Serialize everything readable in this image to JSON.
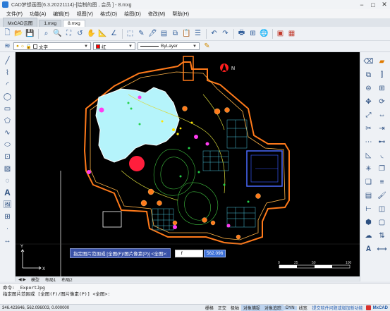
{
  "window": {
    "title": "CAD梦想画图(6.3.20221114)-[绘制的图 , 会员 ] - 8.mxg",
    "minimize_glyph": "−",
    "maximize_glyph": "□",
    "close_glyph": "✕"
  },
  "menu": [
    "文件(F)",
    "功能(A)",
    "编辑(E)",
    "视图(V)",
    "格式(O)",
    "绘图(D)",
    "修改(M)",
    "帮助(H)"
  ],
  "tabs": [
    {
      "label": "MxCAD云图",
      "active": false
    },
    {
      "label": "1.mxg",
      "active": false
    },
    {
      "label": "8.mxg",
      "active": true
    }
  ],
  "toolbar_icons": [
    "new-file-icon",
    "open-folder-icon",
    "save-icon",
    "zoom-window-icon",
    "zoom-realtime-icon",
    "zoom-extents-icon",
    "zoom-previous-icon",
    "pan-hand-icon",
    "measure-icon",
    "angle-icon",
    "select-box-icon",
    "edit-text-icon",
    "pen-icon",
    "layer-icon",
    "copy-icon",
    "paste-icon",
    "properties-icon",
    "undo-icon",
    "redo-icon",
    "print-icon",
    "publish-icon",
    "web-icon",
    "pdf-export-icon",
    "image-export-icon"
  ],
  "properties": {
    "layer_value": "文字",
    "color_value": "红",
    "linetype_value": "ByLayer"
  },
  "colors": {
    "canvas_bg": "#000000",
    "prompt_bg": "#3a52a8",
    "accent": "#1f5aa8",
    "pond": "#b5f4fb",
    "wall": "#ff7a1a",
    "hatch": "#4ac2d6"
  },
  "canvas": {
    "north_label": "N",
    "coord_label_x": "X",
    "coord_label_y": "Y",
    "scale_labels": [
      "0",
      "25",
      "50",
      "100"
    ]
  },
  "prompt": {
    "text": "指定图片范围或 [全图(F)/图片像素(P)] <全图>:",
    "input": "f",
    "value": "562.096"
  },
  "layout_tabs": [
    "模型",
    "布局1",
    "布局2"
  ],
  "command_lines": [
    "命令: _ExportJpg",
    "指定图片范围或 [全图(F)/图片像素(P)] <全图>:"
  ],
  "status": {
    "coords": "346.423646, 562.096003, 0.000000",
    "buttons": [
      {
        "label": "栅格",
        "on": false
      },
      {
        "label": "正交",
        "on": false
      },
      {
        "label": "极轴",
        "on": false
      },
      {
        "label": "对象捕捉",
        "on": true
      },
      {
        "label": "对象追踪",
        "on": true
      },
      {
        "label": "DYN",
        "on": true
      },
      {
        "label": "线宽",
        "on": false
      }
    ],
    "link": "提交软件问题或增加新功能",
    "brand": "MxCAD"
  },
  "left_icons": [
    "line-icon",
    "polyline-icon",
    "arc-icon",
    "circle-icon",
    "rectangle-icon",
    "polygon-icon",
    "spline-icon",
    "ellipse-icon",
    "insert-block-icon",
    "hatch-icon",
    "region-icon",
    "text-icon",
    "image-icon",
    "table-icon",
    "point-icon",
    "dimension-icon"
  ],
  "right_icons": [
    "erase-icon",
    "eraser-icon",
    "copy-icon",
    "mirror-icon",
    "offset-icon",
    "array-icon",
    "move-icon",
    "rotate-icon",
    "scale-icon",
    "stretch-icon",
    "trim-icon",
    "extend-icon",
    "break-icon",
    "join-icon",
    "chamfer-icon",
    "fillet-icon",
    "explode-icon",
    "group-icon",
    "ungroup-icon",
    "align-icon",
    "layer-prop-icon",
    "match-icon",
    "measure-icon",
    "area-icon",
    "3d-box-icon",
    "wipeout-icon",
    "revcloud-icon",
    "draworder-icon",
    "text-style-icon",
    "dim-style-icon"
  ]
}
